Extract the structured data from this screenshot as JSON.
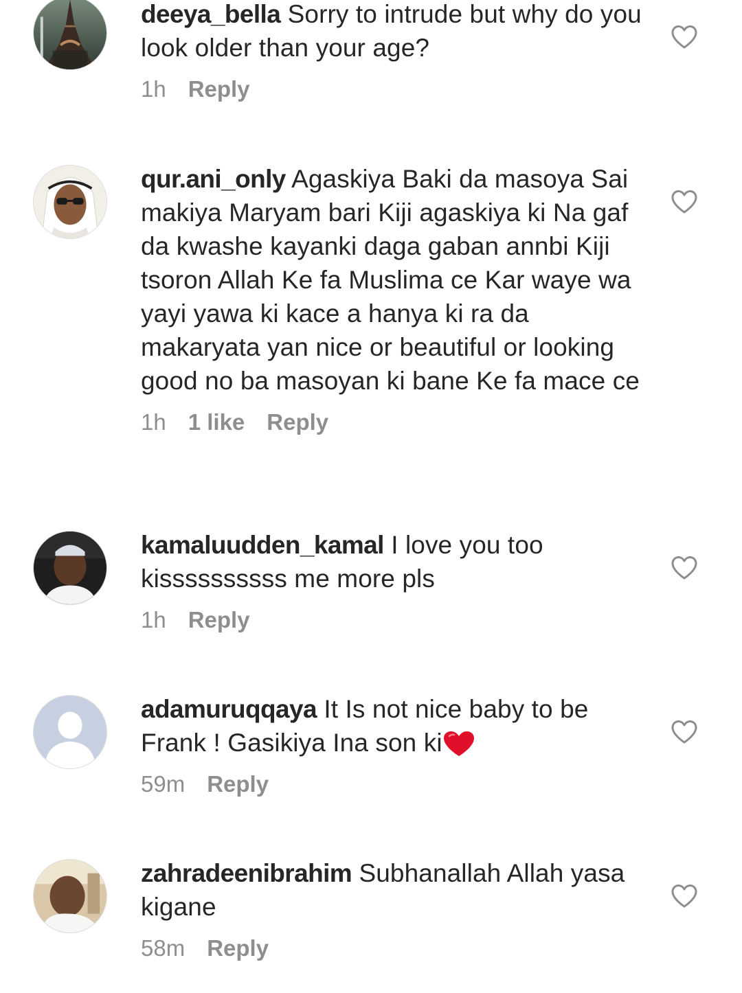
{
  "comments": [
    {
      "username": "deeya_bella",
      "text": "Sorry to intrude but why do you look older than your age?",
      "time": "1h",
      "likes": "",
      "reply": "Reply",
      "avatar": "eiffel-tower-photo"
    },
    {
      "username": "qur.ani_only",
      "text": "Agaskiya Baki da masoya Sai makiya Maryam bari Kiji agaskiya ki Na gaf da kwashe kayanki daga gaban annbi Kiji tsoron Allah Ke fa Muslima ce Kar waye wa yayi yawa ki kace a hanya ki ra da makaryata yan nice or beautiful or looking good no ba masoyan ki bane Ke fa mace ce",
      "time": "1h",
      "likes": "1 like",
      "reply": "Reply",
      "avatar": "man-with-sunglasses-photo"
    },
    {
      "username": "kamaluudden_kamal",
      "text": "I love you too kissssssssss me more pls",
      "time": "1h",
      "likes": "",
      "reply": "Reply",
      "avatar": "man-in-car-photo"
    },
    {
      "username": "adamuruqqaya",
      "text": "It Is not nice baby to be Frank ! Gasikiya Ina son ki",
      "time": "59m",
      "likes": "",
      "reply": "Reply",
      "avatar": "default-avatar",
      "emoji": "red-heart-emoji"
    },
    {
      "username": "zahradeenibrahim",
      "text": "Subhanallah Allah yasa kigane",
      "time": "58m",
      "likes": "",
      "reply": "Reply",
      "avatar": "man-selfie-photo"
    }
  ],
  "colors": {
    "text": "#262626",
    "meta": "#8e8e8e",
    "heart_outline": "#8e8e8e",
    "emoji_heart": "#e0102a"
  }
}
